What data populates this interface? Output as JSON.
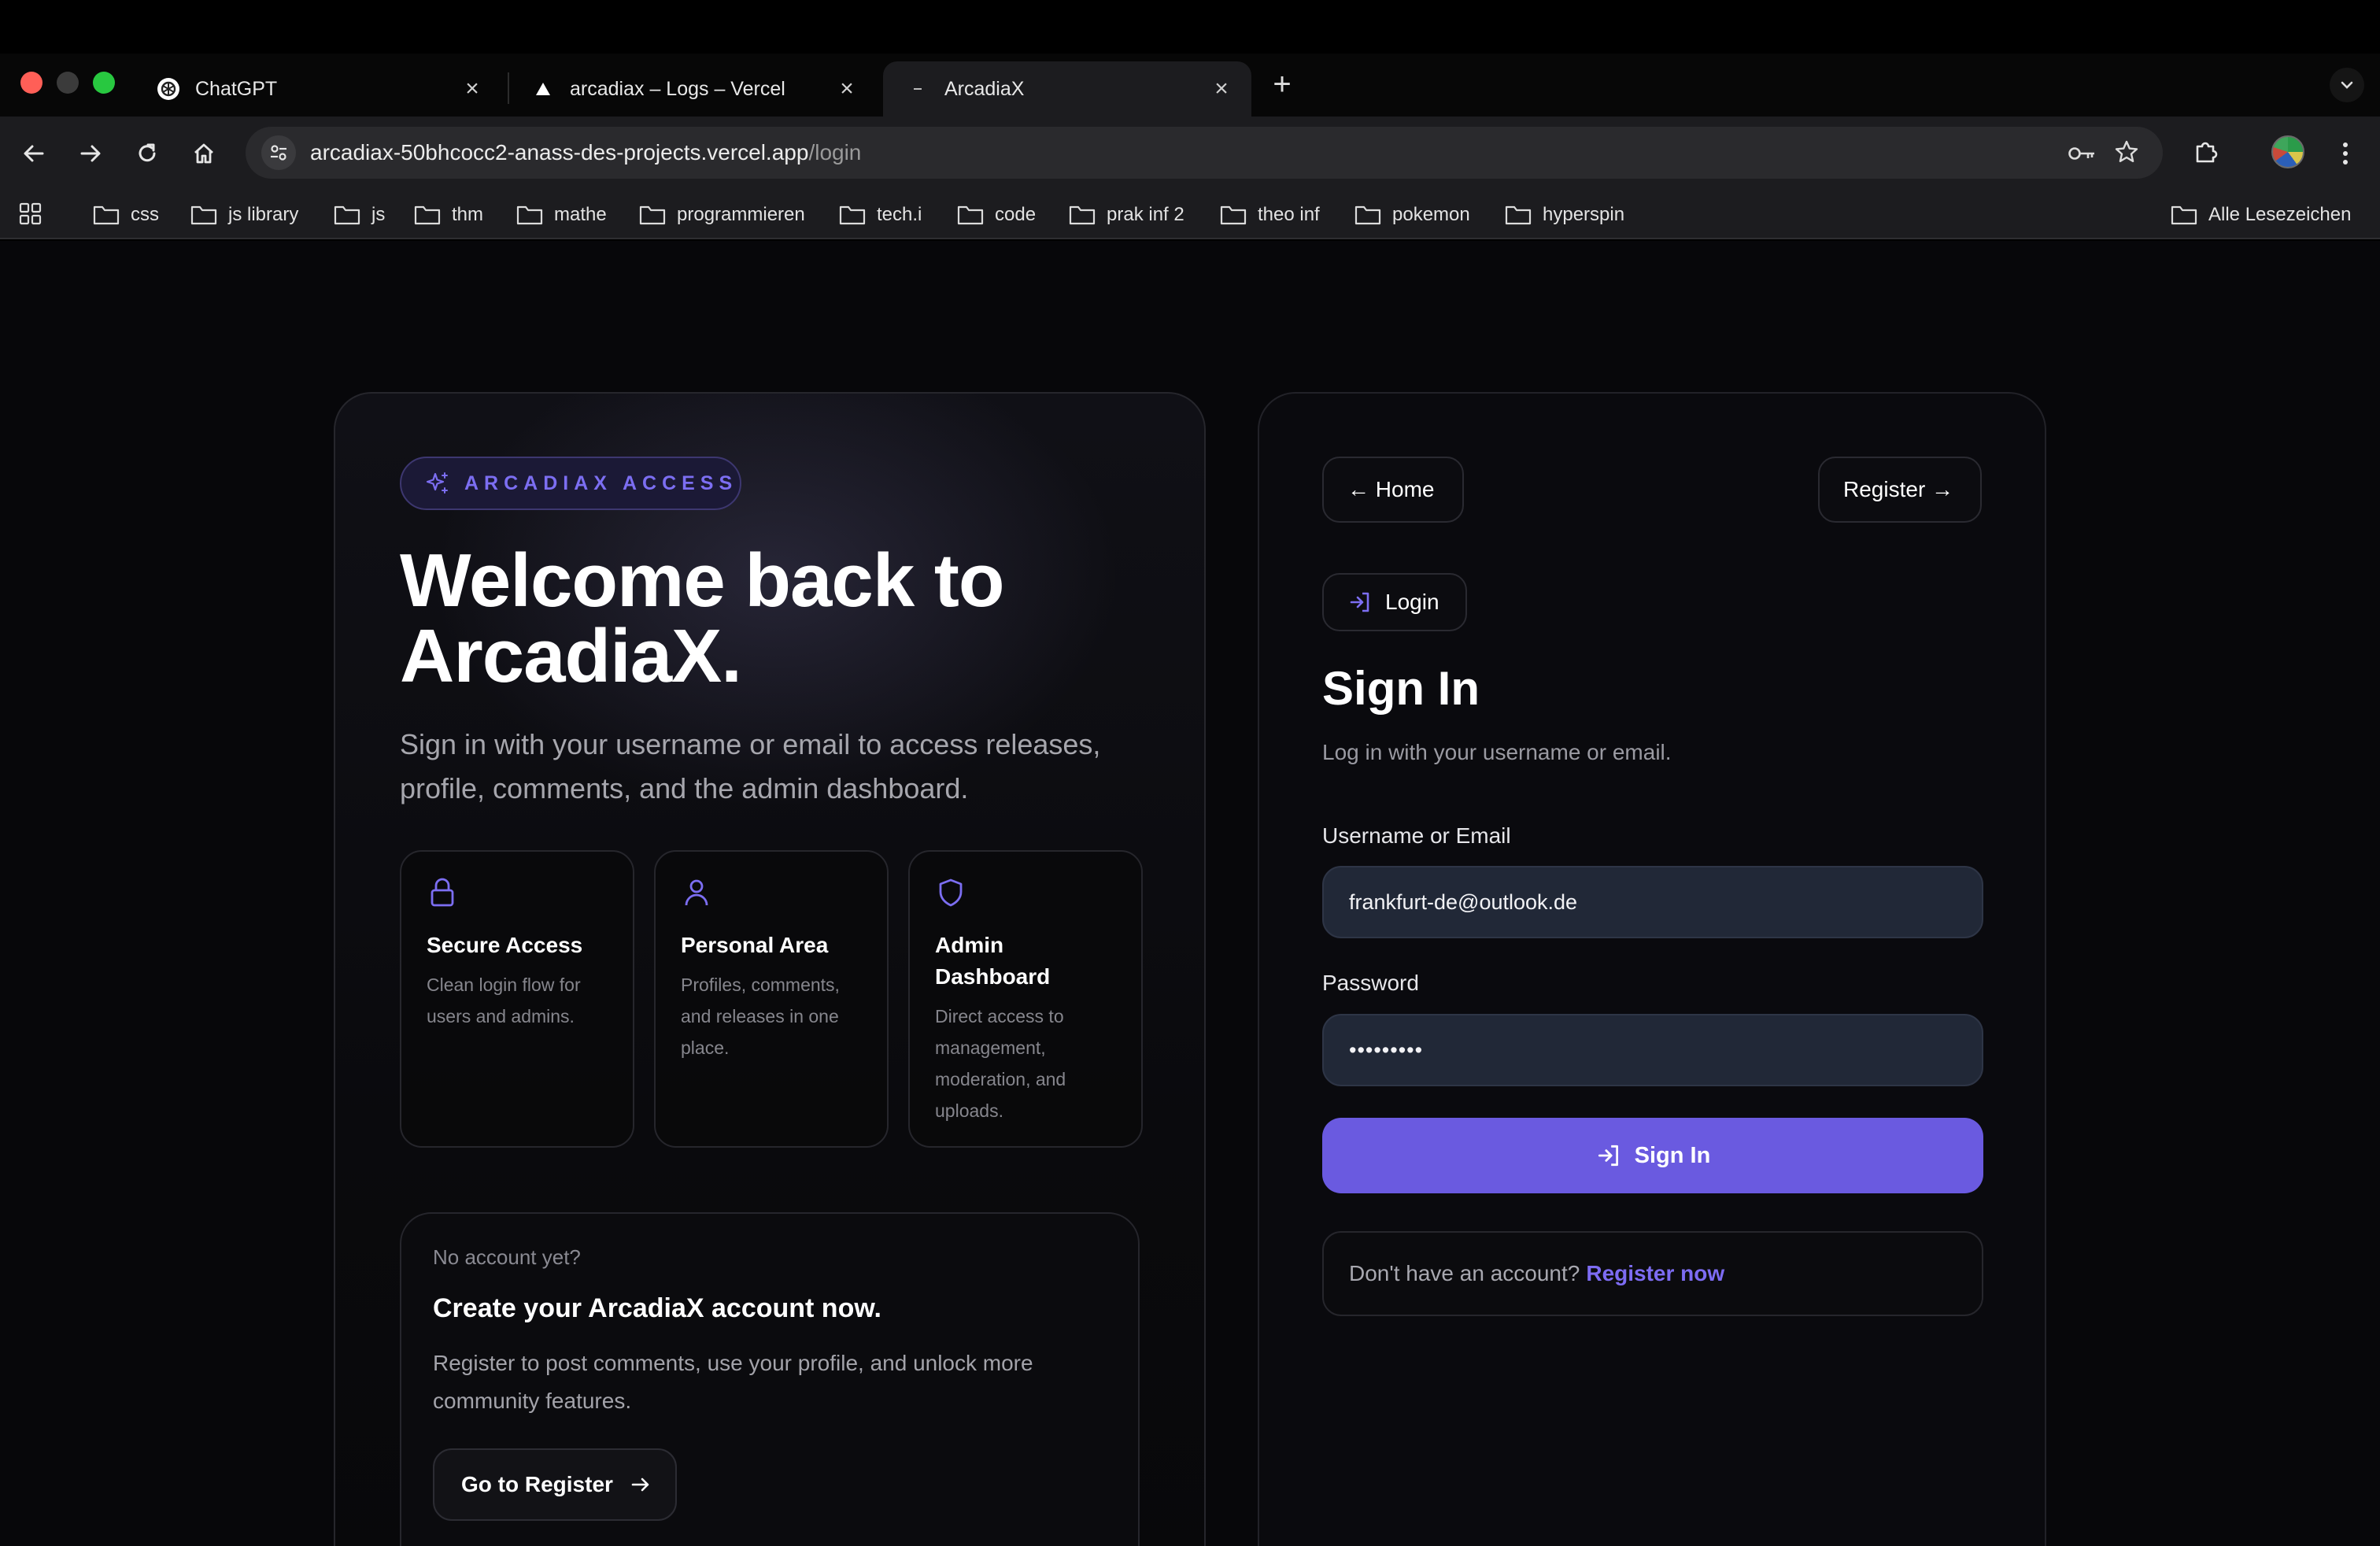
{
  "browser": {
    "tabs": [
      {
        "title": "ChatGPT",
        "close": "×",
        "active": false
      },
      {
        "title": "arcadiax – Logs – Vercel",
        "close": "×",
        "active": false
      },
      {
        "title": "ArcadiaX",
        "close": "×",
        "active": true
      }
    ],
    "new_tab": "+",
    "url_host": "arcadiax-50bhcocc2-anass-des-projects.vercel.app",
    "url_path": "/login",
    "bookmarks": [
      "css",
      "js library",
      "js",
      "thm",
      "mathe",
      "programmieren",
      "tech.i",
      "code",
      "prak inf 2",
      "theo inf",
      "pokemon",
      "hyperspin"
    ],
    "all_bookmarks": "Alle Lesezeichen"
  },
  "hero": {
    "badge": "ARCADIAX ACCESS",
    "title_line1": "Welcome back to",
    "title_line2": "ArcadiaX.",
    "subtitle": "Sign in with your username or email to access releases, profile, comments, and the admin dashboard."
  },
  "features": [
    {
      "icon": "lock-icon",
      "title": "Secure Access",
      "text": "Clean login flow for users and admins."
    },
    {
      "icon": "user-icon",
      "title": "Personal Area",
      "text": "Profiles, comments, and releases in one place."
    },
    {
      "icon": "shield-icon",
      "title": "Admin Dashboard",
      "text": "Direct access to management, moderation, and uploads."
    }
  ],
  "register_promo": {
    "eyebrow": "No account yet?",
    "title": "Create your ArcadiaX account now.",
    "text": "Register to post comments, use your profile, and unlock more community features.",
    "button": "Go to Register"
  },
  "auth": {
    "home": "← Home",
    "register": "Register →",
    "login_tag": "Login",
    "title": "Sign In",
    "subtitle": "Log in with your username or email.",
    "username_label": "Username or Email",
    "username_value": "frankfurt-de@outlook.de",
    "password_label": "Password",
    "password_value": "•••••••••",
    "submit": "Sign In",
    "no_account": "Don't have an account?",
    "register_now": "Register now"
  },
  "colors": {
    "accent": "#6a5ae0",
    "accent_text": "#7c6ef2",
    "field_bg": "#212837"
  }
}
